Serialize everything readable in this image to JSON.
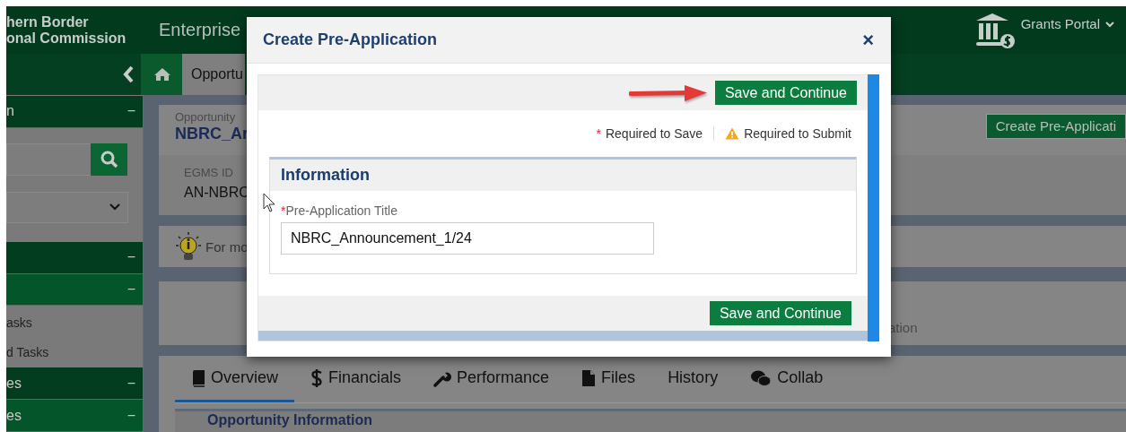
{
  "header": {
    "org_lines": [
      "hern Border",
      "onal Commission"
    ],
    "app_title": "Enterprise",
    "portal_menu": "Grants Portal"
  },
  "breadcrumb": {
    "label": "Opportu"
  },
  "sidebar": {
    "items": [
      {
        "kind": "section",
        "label": "n",
        "toggle": "−"
      },
      {
        "kind": "search"
      },
      {
        "kind": "select"
      },
      {
        "kind": "section",
        "toggle": "−"
      },
      {
        "kind": "subsection",
        "toggle": "−"
      },
      {
        "kind": "link",
        "label": "asks"
      },
      {
        "kind": "link",
        "label": "d Tasks"
      },
      {
        "kind": "section",
        "label": "es",
        "toggle": "−"
      },
      {
        "kind": "subsection",
        "label": "es",
        "toggle": "−"
      }
    ]
  },
  "opportunity": {
    "label": "Opportunity",
    "name": "NBRC_Ar",
    "id_label": "EGMS ID",
    "id_value": "AN-NBRC",
    "action": "Create Pre-Applicati"
  },
  "info_banner": {
    "text": "For mo"
  },
  "status_card": {
    "text": "ation"
  },
  "detail_tabs": [
    {
      "kind": "book",
      "label": "Overview",
      "selected": true
    },
    {
      "kind": "dollar",
      "label": "Financials",
      "selected": false
    },
    {
      "kind": "wrench",
      "label": "Performance",
      "selected": false
    },
    {
      "kind": "file",
      "label": "Files",
      "selected": false
    },
    {
      "kind": "none",
      "label": "History",
      "selected": false
    },
    {
      "kind": "chat",
      "label": "Collab",
      "selected": false
    }
  ],
  "detail_section": {
    "title": "Opportunity Information"
  },
  "modal": {
    "title": "Create Pre-Application",
    "close": "×",
    "top_button": "Save and Continue",
    "legend": [
      {
        "kind": "required_save",
        "mark": "*",
        "label": "Required to Save"
      },
      {
        "kind": "required_submit",
        "label": "Required to Submit"
      }
    ],
    "section_title": "Information",
    "field": {
      "required_mark": "*",
      "label": "Pre-Application Title",
      "value": "NBRC_Announcement_1/24"
    },
    "bottom_button": "Save and Continue"
  }
}
